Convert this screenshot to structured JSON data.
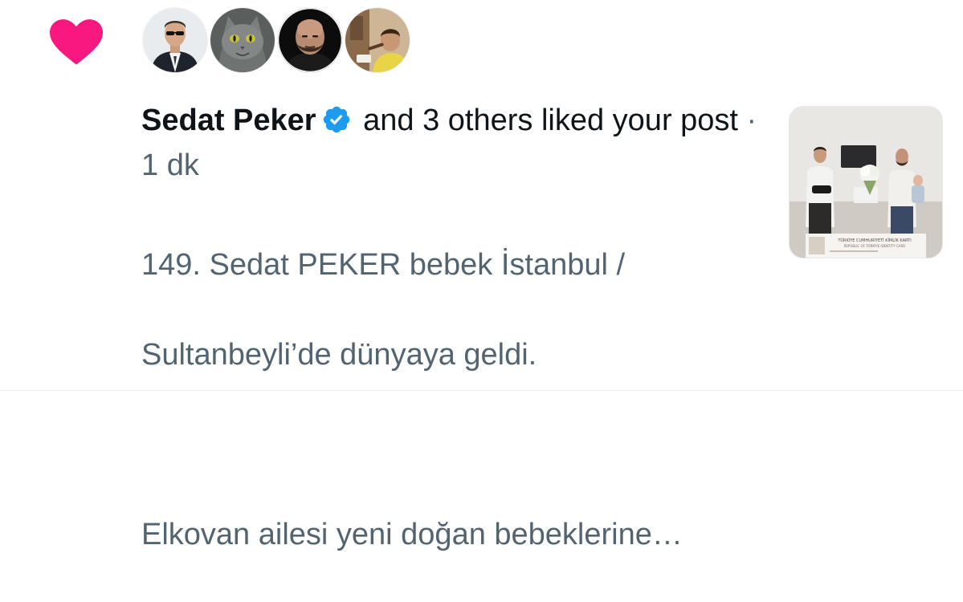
{
  "notification": {
    "type_icon": "heart-icon",
    "type_icon_color": "#f91880",
    "avatars": [
      {
        "icon": "user-avatar-man-sunglasses"
      },
      {
        "icon": "user-avatar-gray-cat"
      },
      {
        "icon": "user-avatar-bald-man"
      },
      {
        "icon": "user-avatar-child"
      }
    ],
    "actor_name": "Sedat Peker",
    "verified_icon": "verified-badge-icon",
    "verified_color": "#1d9bf0",
    "action_text": "and 3 others liked your post",
    "separator": "·",
    "time": "1 dk",
    "post_preview_line1": "149. Sedat PEKER bebek İstanbul /",
    "post_preview_line2": "Sultanbeyli’de dünyaya geldi.",
    "post_preview_line3": "Elkovan ailesi yeni doğan bebeklerine…",
    "thumbnail": {
      "icon": "post-thumbnail-image",
      "card_title": "TÜRKİYE CUMHURİYETİ KİMLİK KARTI",
      "card_subtitle": "REPUBLIC OF TÜRKİYE IDENTITY CARD"
    }
  }
}
